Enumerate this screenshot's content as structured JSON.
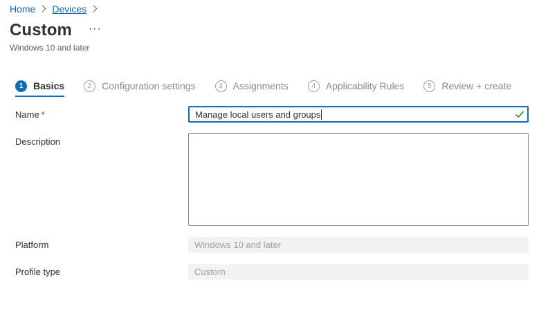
{
  "breadcrumb": {
    "items": [
      {
        "label": "Home"
      },
      {
        "label": "Devices"
      }
    ]
  },
  "header": {
    "title": "Custom",
    "more_label": "···",
    "subtitle": "Windows 10 and later"
  },
  "steps": [
    {
      "num": "1",
      "label": "Basics",
      "active": true
    },
    {
      "num": "2",
      "label": "Configuration settings",
      "active": false
    },
    {
      "num": "3",
      "label": "Assignments",
      "active": false
    },
    {
      "num": "4",
      "label": "Applicability Rules",
      "active": false
    },
    {
      "num": "5",
      "label": "Review + create",
      "active": false
    }
  ],
  "form": {
    "name_label": "Name",
    "required_mark": "*",
    "name_value": "Manage local users and groups",
    "description_label": "Description",
    "description_value": "",
    "platform_label": "Platform",
    "platform_value": "Windows 10 and later",
    "profile_type_label": "Profile type",
    "profile_type_value": "Custom"
  },
  "colors": {
    "accent": "#0f6cbd",
    "valid_check": "#107c10",
    "required": "#a4262c"
  },
  "icons": {
    "breadcrumb_separator": "chevron-right-icon",
    "valid": "checkmark-icon",
    "more": "more-horizontal-icon"
  }
}
